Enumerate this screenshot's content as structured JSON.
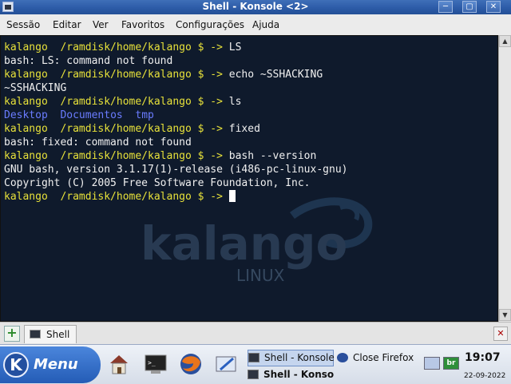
{
  "window": {
    "title": "Shell - Konsole <2>",
    "minimize_icon": "minimize-icon",
    "maximize_icon": "maximize-icon",
    "close_icon": "close-icon"
  },
  "menu": [
    "Sessão",
    "Editar",
    "Ver",
    "Favoritos",
    "Configurações",
    "Ajuda"
  ],
  "terminal": {
    "prompt": "kalango  /ramdisk/home/kalango $ -> ",
    "lines": [
      {
        "type": "cmd",
        "text": "LS"
      },
      {
        "type": "out",
        "text": "bash: LS: command not found"
      },
      {
        "type": "cmd",
        "text": "echo ~SSHACKING"
      },
      {
        "type": "out",
        "text": "~SSHACKING"
      },
      {
        "type": "cmd",
        "text": "ls"
      },
      {
        "type": "dirs",
        "items": [
          "Desktop",
          "Documentos",
          "tmp"
        ]
      },
      {
        "type": "cmd",
        "text": "fixed"
      },
      {
        "type": "out",
        "text": "bash: fixed: command not found"
      },
      {
        "type": "cmd",
        "text": "bash --version"
      },
      {
        "type": "out",
        "text": "GNU bash, version 3.1.17(1)-release (i486-pc-linux-gnu)"
      },
      {
        "type": "out",
        "text": "Copyright (C) 2005 Free Software Foundation, Inc."
      },
      {
        "type": "cmd",
        "text": ""
      }
    ],
    "watermark_text": "kalango",
    "watermark_sub": "LINUX",
    "colors": {
      "background": "#0f1a2c",
      "prompt": "#e7e13a",
      "text": "#f0f0f0",
      "dir": "#6a7cff"
    }
  },
  "tabs": [
    {
      "label": "Shell",
      "icon": "terminal-icon"
    }
  ],
  "taskbar": {
    "menu_label": "Menu",
    "tasks": [
      {
        "label": "Shell - Konsole",
        "icon": "terminal-icon",
        "active": true
      },
      {
        "label": "Close Firefox",
        "icon": "firefox-icon",
        "active": false
      },
      {
        "label": "Shell - Konso",
        "icon": "terminal-icon",
        "active": false
      }
    ],
    "tray_lang": "br",
    "time": "19:07",
    "date": "22-09-2022"
  }
}
